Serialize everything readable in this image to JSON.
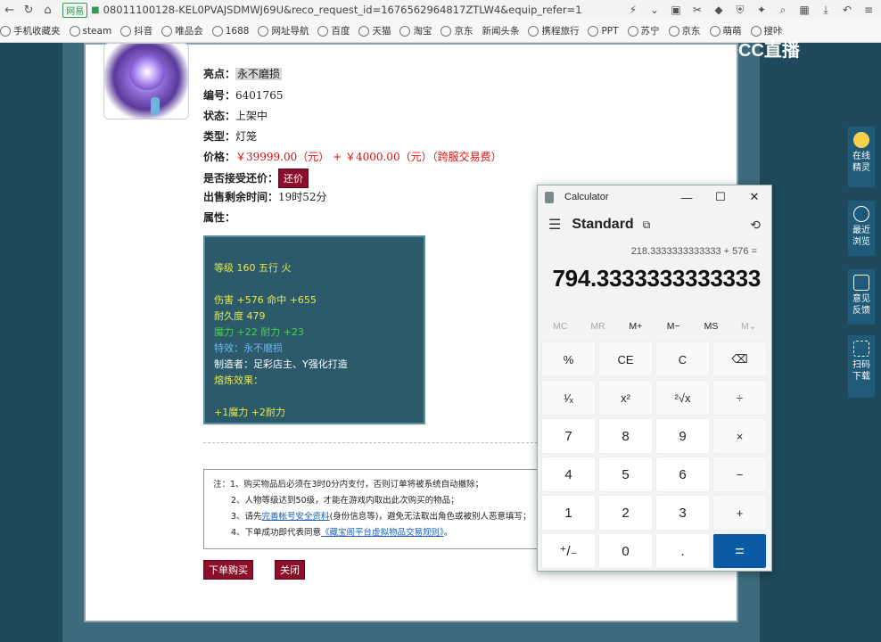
{
  "browser": {
    "secure_label": "网易",
    "url": "08011100128-KEL0PVAJSDMWJ69U&reco_request_id=1676562964817ZTLW4&equip_refer=1",
    "bookmarks": [
      "手机收藏夹",
      "steam",
      "抖音",
      "唯品会",
      "1688",
      "网址导航",
      "百度",
      "天猫",
      "淘宝",
      "京东",
      "新闻头条",
      "携程旅行",
      "PPT",
      "苏宁",
      "京东",
      "萌萌",
      "搜咔"
    ]
  },
  "site": {
    "logo": "CC直播"
  },
  "item": {
    "highlight_label": "亮点：",
    "highlight_value": "永不磨损",
    "id_label": "编号：",
    "id_value": "6401765",
    "status_label": "状态：",
    "status_value": "上架中",
    "type_label": "类型：",
    "type_value": "灯笼",
    "price_label": "价格：",
    "price_value": "￥39999.00（元） + ￥4000.00（元）（跨服交易费）",
    "bargain_label": "是否接受还价：",
    "bargain_button": "还价",
    "time_label": "出售剩余时间：",
    "time_value": "19时52分",
    "attr_label": "属性："
  },
  "attributes": {
    "level_line": "等级 160 五行 火",
    "damage_line": "伤害 +576 命中 +655",
    "durability_line": "耐久度 479",
    "magic_line": "魔力 +22 耐力 +23",
    "effect_line": "特效：永不磨损",
    "maker_line": "制造者：足彩店主、Y强化打造",
    "refine_label": "熔炼效果：",
    "refine_line": "+1魔力 +2耐力"
  },
  "notes": {
    "line1": "注：1、购买物品后必须在3时0分内支付，否则订单将被系统自动撤除；",
    "line2": "2、人物等级达到50级，才能在游戏内取出此次购买的物品；",
    "line3_pre": "3、请先",
    "line3_link": "完善帐号安全资料",
    "line3_post": "(身份信息等)，避免无法取出角色或被别人恶意填写；",
    "line4_pre": "4、下单成功即代表同意",
    "line4_link": "《藏宝阁平台虚拟物品交易规则》",
    "line4_post": "。"
  },
  "actions": {
    "buy": "下单购买",
    "close": "关闭"
  },
  "sidebar": {
    "items": [
      {
        "label": "在线精灵"
      },
      {
        "label": "最近浏览"
      },
      {
        "label": "意见反馈"
      },
      {
        "label": "扫码下载"
      }
    ]
  },
  "calculator": {
    "title": "Calculator",
    "mode": "Standard",
    "expression": "218.3333333333333 + 576 =",
    "result": "794.3333333333333",
    "memory": [
      "MC",
      "MR",
      "M+",
      "M−",
      "MS",
      "M⌄"
    ],
    "keys": [
      "%",
      "CE",
      "C",
      "⌫",
      "¹⁄ₓ",
      "x²",
      "²√x",
      "÷",
      "7",
      "8",
      "9",
      "×",
      "4",
      "5",
      "6",
      "−",
      "1",
      "2",
      "3",
      "+",
      "⁺/₋",
      "0",
      ".",
      "="
    ]
  }
}
